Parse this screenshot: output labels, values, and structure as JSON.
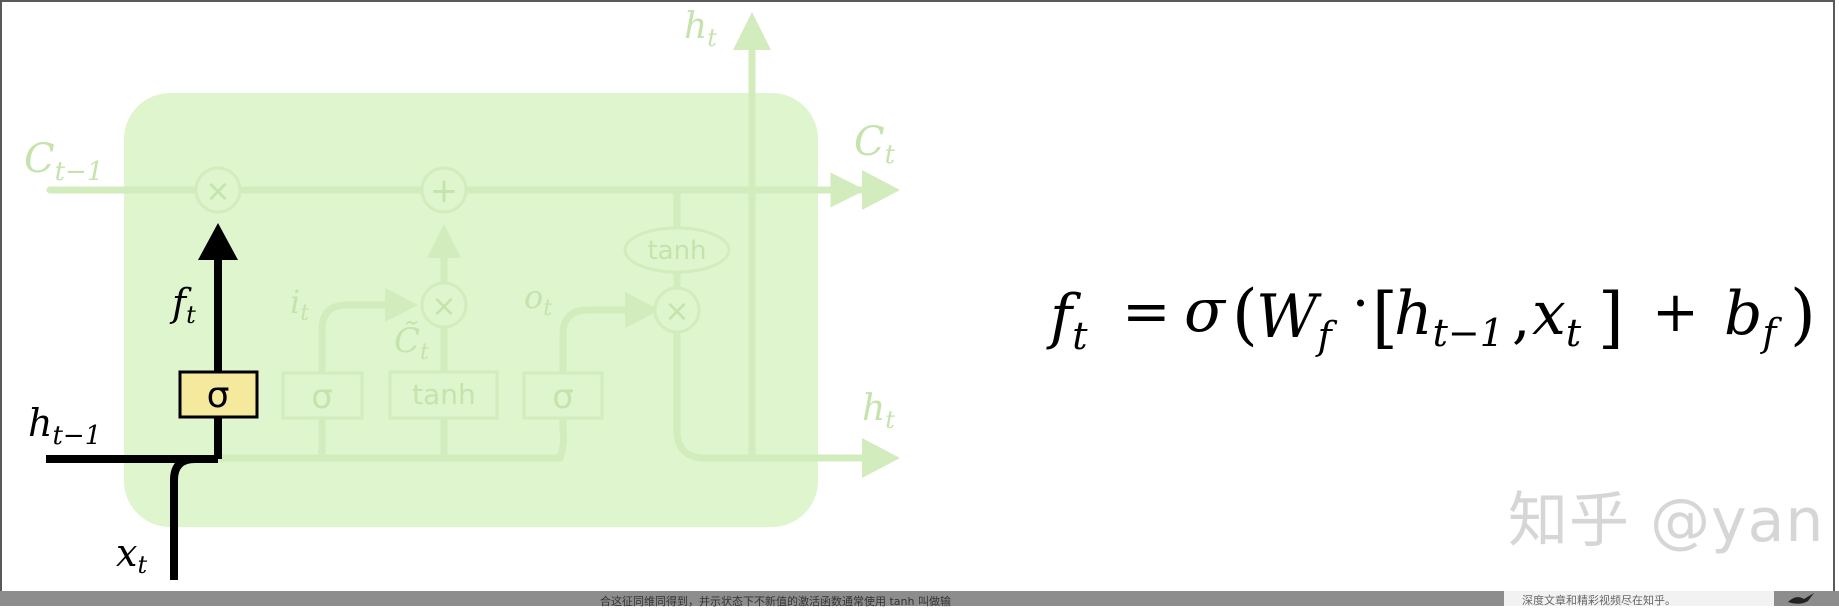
{
  "diagram": {
    "labels": {
      "c_prev_main": "C",
      "c_prev_sub": "t−1",
      "c_t_main": "C",
      "c_t_sub": "t",
      "h_top_main": "h",
      "h_top_sub": "t",
      "h_right_main": "h",
      "h_right_sub": "t",
      "h_prev_main": "h",
      "h_prev_sub": "t−1",
      "x_main": "x",
      "x_sub": "t",
      "f_main": "f",
      "f_sub": "t",
      "i_main": "i",
      "i_sub": "t",
      "o_main": "o",
      "o_sub": "t",
      "ctilde_main": "C̃",
      "ctilde_sub": "t"
    },
    "ops": {
      "times": "×",
      "plus": "+",
      "tanh": "tanh",
      "sigma": "σ"
    }
  },
  "equation": {
    "text": "f_t = σ (W_f · [h_{t−1}, x_t] + b_f)",
    "f": "f",
    "f_sub": "t",
    "eq": "=",
    "sigma": "σ",
    "lparen": "(",
    "W": "W",
    "W_sub": "f",
    "dot": "·",
    "lbracket": "[",
    "h": "h",
    "h_sub": "t−1",
    "comma": ",",
    "x": "x",
    "x_sub": "t",
    "rbracket": "]",
    "plus": "+",
    "b": "b",
    "b_sub": "f",
    "rparen": ")"
  },
  "watermark": "知乎 @yan li",
  "bottom_caption": "合这征同维同得到，并示状态下不新值的激活函数通常使用 tanh 叫做输",
  "corner_text": "深度文章和精彩视频尽在知乎。",
  "colors": {
    "cell_fill": "#dff5cd",
    "faded": "#d2ecbe",
    "faded_text": "#c5e3ad",
    "active": "#000000",
    "sigma_box": "#f4e99c"
  }
}
